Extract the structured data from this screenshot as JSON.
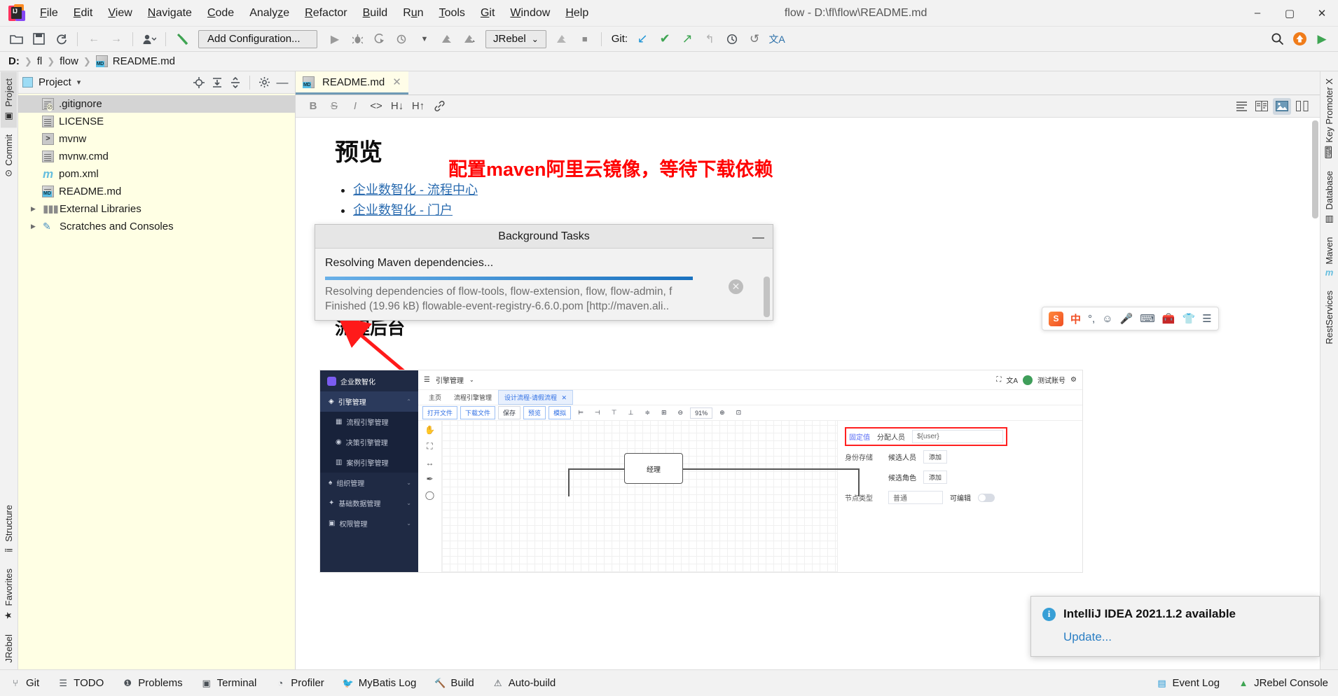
{
  "window": {
    "title": "flow - D:\\fl\\flow\\README.md",
    "minimize": "–",
    "maximize": "▢",
    "close": "✕",
    "logo_text": "IJ"
  },
  "menubar": [
    {
      "label": "File"
    },
    {
      "label": "Edit"
    },
    {
      "label": "View"
    },
    {
      "label": "Navigate"
    },
    {
      "label": "Code"
    },
    {
      "label": "Analyze"
    },
    {
      "label": "Refactor"
    },
    {
      "label": "Build"
    },
    {
      "label": "Run"
    },
    {
      "label": "Tools"
    },
    {
      "label": "Git"
    },
    {
      "label": "Window"
    },
    {
      "label": "Help"
    }
  ],
  "toolbar": {
    "open_icon": "open-folder-icon",
    "save_icon": "save-icon",
    "sync_icon": "sync-icon",
    "back_icon": "←",
    "forward_icon": "→",
    "profile_icon": "user-icon",
    "build_icon": "hammer-icon",
    "add_configuration": "Add Configuration...",
    "run_icon": "▶",
    "debug_icon": "debug-icon",
    "coverage_icon": "coverage-icon",
    "profile_run_icon": "profile-icon",
    "jrebel_label": "JRebel",
    "jrebel_chevron": "⌄",
    "stop_icon": "■",
    "git_label": "Git:",
    "git_update_icon": "↙",
    "git_commit_icon": "✔",
    "git_push_icon": "↗",
    "git_revert_icon": "↰",
    "history_icon": "🕘",
    "undo_icon": "↺",
    "translate_icon": "文A",
    "search_icon": "search-icon",
    "updates_icon": "↑",
    "play_icon": "▶"
  },
  "breadcrumb": {
    "items": [
      "D:",
      "fl",
      "flow",
      "README.md"
    ],
    "separator": "❯"
  },
  "project_panel": {
    "title": "Project",
    "chevron": "▾",
    "tools": [
      "locate-icon",
      "expand-all-icon",
      "collapse-all-icon",
      "settings-icon",
      "hide-icon"
    ],
    "tree": [
      {
        "label": ".gitignore",
        "icon": "gitignore-file-icon",
        "selected": true,
        "expandable": false
      },
      {
        "label": "LICENSE",
        "icon": "text-file-icon",
        "selected": false,
        "expandable": false
      },
      {
        "label": "mvnw",
        "icon": "shell-script-icon",
        "selected": false,
        "expandable": false
      },
      {
        "label": "mvnw.cmd",
        "icon": "text-file-icon",
        "selected": false,
        "expandable": false
      },
      {
        "label": "pom.xml",
        "icon": "maven-pom-icon",
        "selected": false,
        "expandable": false
      },
      {
        "label": "README.md",
        "icon": "markdown-file-icon",
        "selected": false,
        "expandable": false
      },
      {
        "label": "External Libraries",
        "icon": "library-icon",
        "selected": false,
        "expandable": true
      },
      {
        "label": "Scratches and Consoles",
        "icon": "scratches-icon",
        "selected": false,
        "expandable": true
      }
    ]
  },
  "left_tool_window_bars": [
    {
      "label": "Project",
      "selected": true
    },
    {
      "label": "Commit",
      "selected": false
    },
    {
      "label": "Structure",
      "selected": false
    },
    {
      "label": "Favorites",
      "selected": false
    },
    {
      "label": "JRebel",
      "selected": false
    }
  ],
  "right_tool_window_bars": [
    {
      "label": "Key Promoter X"
    },
    {
      "label": "Database"
    },
    {
      "label": "Maven"
    },
    {
      "label": "RestServices"
    }
  ],
  "editor": {
    "tab": {
      "label": "README.md",
      "close": "✕"
    },
    "md_toolbar_left": [
      "B",
      "S",
      "I",
      "<>",
      "H↓",
      "H↑",
      "link-icon"
    ],
    "md_toolbar_right": [
      "editor-only-icon",
      "editor-and-preview-icon",
      "preview-only-icon",
      "split-icon"
    ]
  },
  "preview": {
    "h1": "预览",
    "links": [
      "企业数智化 - 流程中心",
      "企业数智化 - 门户"
    ],
    "annotation": "配置maven阿里云镜像，等待下载依赖",
    "h2": "流程后台"
  },
  "background_tasks": {
    "title": "Background Tasks",
    "minimize": "—",
    "task": "Resolving Maven dependencies...",
    "progress_percent": 100,
    "cancel": "✕",
    "detail_line_1": "Resolving dependencies of flow-tools, flow-extension, flow, flow-admin, f",
    "detail_line_2": "Finished (19.96 kB) flowable-event-registry-6.6.0.pom [http://maven.ali.."
  },
  "inner_screenshot": {
    "brand": "企业数智化",
    "menu": [
      {
        "label": "引擎管理",
        "active": true,
        "chevron": "⌃"
      },
      {
        "label": "流程引擎管理",
        "sub": true
      },
      {
        "label": "决策引擎管理",
        "sub": true
      },
      {
        "label": "案例引擎管理",
        "sub": true
      },
      {
        "label": "组织管理",
        "chevron": "⌄"
      },
      {
        "label": "基础数据管理",
        "chevron": "⌄"
      },
      {
        "label": "权限管理",
        "chevron": "⌄"
      }
    ],
    "topbar": {
      "menu_icon": "hamburger-icon",
      "title": "引擎管理",
      "chevron": "⌄",
      "fullscreen_icon": "⛶",
      "lang_icon": "文A",
      "user": "测试账号",
      "settings_icon": "gear-icon"
    },
    "tabs": [
      {
        "label": "主页",
        "active": false
      },
      {
        "label": "流程引擎管理",
        "active": false
      },
      {
        "label": "设计流程-请假流程",
        "active": true,
        "close": "✕"
      }
    ],
    "buttons": [
      "打开文件",
      "下载文件",
      "保存",
      "预览",
      "模拟"
    ],
    "zoom_level": "91%",
    "canvas_node": "经理",
    "properties": [
      {
        "key": "固定值",
        "sub": "分配人员",
        "value": "${user}",
        "highlighted": true
      },
      {
        "key": "身份存储",
        "sub": "候选人员",
        "action": "添加"
      },
      {
        "key": "",
        "sub": "候选角色",
        "action": "添加"
      },
      {
        "key": "节点类型",
        "sub": "普通",
        "toggle_label": "可编辑"
      }
    ]
  },
  "ime_bar": {
    "logo": "S",
    "mode": "中",
    "punct": "°,",
    "emoji_icon": "☺",
    "mic_icon": "🎤",
    "keyboard_icon": "⌨",
    "toolbox_icon": "🧰",
    "skin_icon": "👕",
    "menu_icon": "☰"
  },
  "notification": {
    "icon": "info-icon",
    "title": "IntelliJ IDEA 2021.1.2 available",
    "action": "Update..."
  },
  "statusbar": {
    "left": [
      {
        "label": "Git",
        "icon": "git-branch-icon"
      },
      {
        "label": "TODO",
        "icon": "todo-icon"
      },
      {
        "label": "Problems",
        "icon": "problems-icon"
      },
      {
        "label": "Terminal",
        "icon": "terminal-icon"
      },
      {
        "label": "Profiler",
        "icon": "profiler-icon"
      },
      {
        "label": "MyBatis Log",
        "icon": "mybatis-icon"
      },
      {
        "label": "Build",
        "icon": "build-icon"
      },
      {
        "label": "Auto-build",
        "icon": "warning-icon"
      }
    ],
    "right": [
      {
        "label": "Event Log",
        "icon": "event-log-icon"
      },
      {
        "label": "JRebel Console",
        "icon": "jrebel-icon"
      }
    ]
  },
  "colors": {
    "accent_blue": "#2b6cb0",
    "annotation_red": "#ff0000",
    "tree_bg": "#ffffe4",
    "progress": "#1a72c0"
  }
}
